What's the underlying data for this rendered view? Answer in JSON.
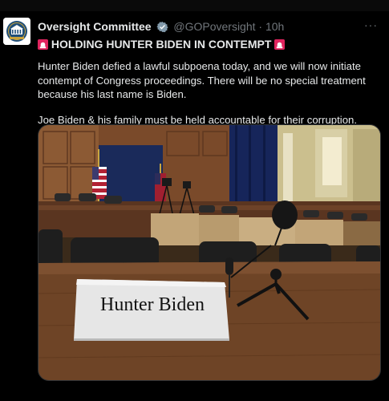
{
  "account": {
    "name": "Oversight Committee",
    "handle": "@GOPoversight",
    "separator": "·",
    "time": "10h",
    "more": "···"
  },
  "icons": {
    "verified": "verified-badge-icon",
    "siren": "rotating-light-icon",
    "more": "more-options-icon"
  },
  "tweet": {
    "headline": "HOLDING HUNTER BIDEN IN CONTEMPT",
    "paragraph1": "Hunter Biden defied a lawful subpoena today, and we will now initiate contempt of Congress proceedings. There will be no special treatment because his last name is Biden.",
    "paragraph2": "Joe Biden & his family must be held accountable for their corruption."
  },
  "photo": {
    "nameplate": "Hunter Biden"
  },
  "colors": {
    "background": "#000000",
    "text": "#e7e9ea",
    "muted": "#71767b",
    "verified": "#829aab",
    "siren": "#e0245e"
  }
}
